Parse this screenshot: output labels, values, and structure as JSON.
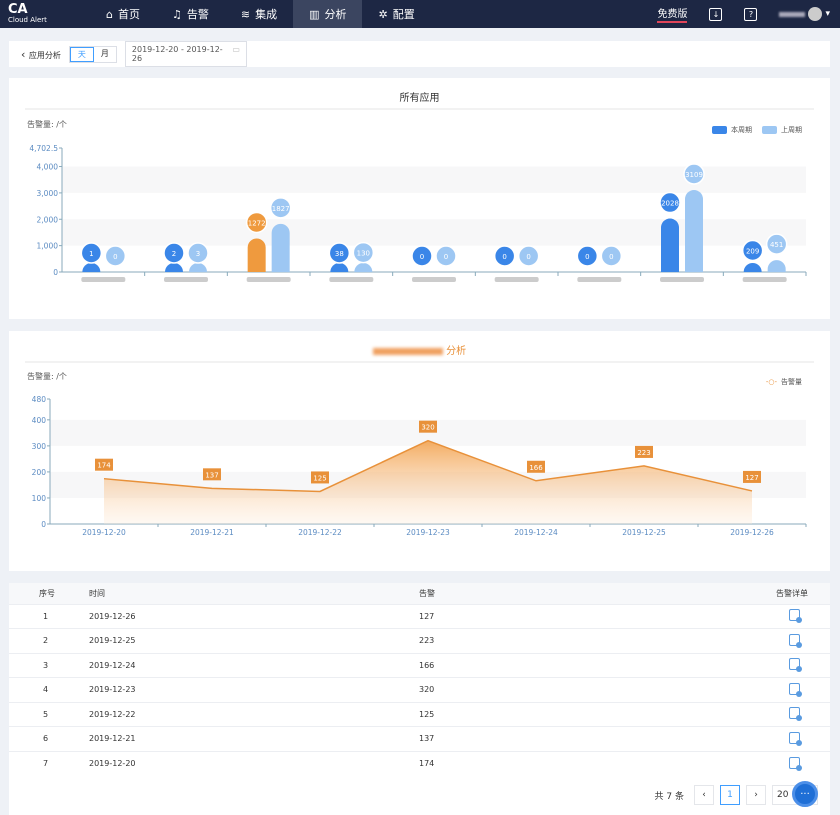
{
  "nav": {
    "logo": "CA",
    "logo_sub": "Cloud Alert",
    "items": [
      {
        "label": "首页",
        "icon": "home-icon"
      },
      {
        "label": "告警",
        "icon": "alarm-icon"
      },
      {
        "label": "集成",
        "icon": "layers-icon"
      },
      {
        "label": "分析",
        "icon": "chart-icon",
        "active": true
      },
      {
        "label": "配置",
        "icon": "gear-icon"
      }
    ],
    "free": "免费版"
  },
  "toolbar": {
    "back": "应用分析",
    "day": "天",
    "month": "月",
    "date_range": "2019-12-20 - 2019-12-26"
  },
  "colors": {
    "current": "#3a86e8",
    "previous": "#9dc7f3",
    "highlight": "#ef9a3e",
    "line": "#e8913a"
  },
  "chart_data": [
    {
      "type": "bar",
      "title": "所有应用",
      "unit_label": "告警量: /个",
      "ylim": [
        0,
        4702.5
      ],
      "yticks": [
        0,
        1000,
        2000,
        3000,
        4000,
        4702.5
      ],
      "legend": [
        "本周期",
        "上周期"
      ],
      "legend_position": "top-right",
      "grid": true,
      "categories": [
        "",
        "",
        "",
        "",
        "",
        "",
        "",
        "",
        ""
      ],
      "series": [
        {
          "name": "本周期",
          "values": [
            1,
            2,
            1272,
            38,
            0,
            0,
            0,
            2028,
            209
          ]
        },
        {
          "name": "上周期",
          "values": [
            0,
            3,
            1827,
            130,
            0,
            0,
            0,
            3109,
            451
          ]
        }
      ]
    },
    {
      "type": "area",
      "title": "分析",
      "unit_label": "告警量: /个",
      "ylim": [
        0,
        480
      ],
      "yticks": [
        0,
        100,
        200,
        300,
        400,
        480
      ],
      "legend": [
        "告警量"
      ],
      "legend_position": "top-right",
      "grid": true,
      "x": [
        "2019-12-20",
        "2019-12-21",
        "2019-12-22",
        "2019-12-23",
        "2019-12-24",
        "2019-12-25",
        "2019-12-26"
      ],
      "series": [
        {
          "name": "告警量",
          "values": [
            174,
            137,
            125,
            320,
            166,
            223,
            127
          ]
        }
      ]
    }
  ],
  "table": {
    "headers": [
      "序号",
      "时间",
      "告警",
      "告警详单"
    ],
    "rows": [
      [
        "1",
        "2019-12-26",
        "127"
      ],
      [
        "2",
        "2019-12-25",
        "223"
      ],
      [
        "3",
        "2019-12-24",
        "166"
      ],
      [
        "4",
        "2019-12-23",
        "320"
      ],
      [
        "5",
        "2019-12-22",
        "125"
      ],
      [
        "6",
        "2019-12-21",
        "137"
      ],
      [
        "7",
        "2019-12-20",
        "174"
      ]
    ]
  },
  "pager": {
    "total": "共 7 条",
    "page": "1",
    "size": "20",
    "prev": "‹",
    "next": "›"
  }
}
